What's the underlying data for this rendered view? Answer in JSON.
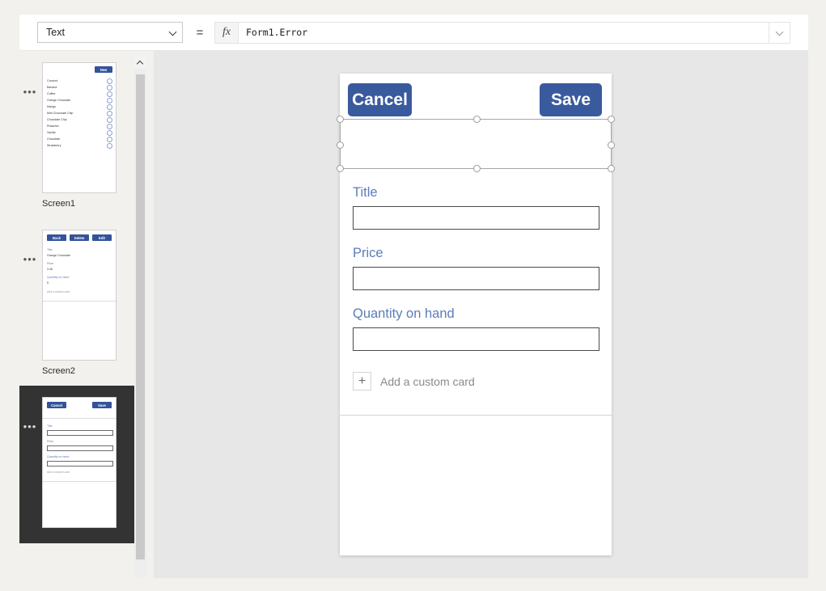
{
  "formula_bar": {
    "property_value": "Text",
    "equals": "=",
    "fx_label": "fx",
    "formula_value": "Form1.Error",
    "expand_icon": "chevron-down-icon",
    "dropdown_icon": "chevron-down-icon"
  },
  "screens": [
    {
      "name": "Screen1",
      "selected": false,
      "menu": "•••",
      "type": "browse",
      "new_button": "New",
      "items": [
        "Coconut",
        "Banana",
        "Coffee",
        "Orange Chocolate",
        "Mango",
        "Mint Chocolate Chip",
        "Chocolate Chip",
        "Pistachio",
        "Vanilla",
        "Chocolate",
        "Strawberry"
      ]
    },
    {
      "name": "Screen2",
      "selected": false,
      "menu": "•••",
      "type": "detail",
      "buttons": [
        "Back",
        "Delete",
        "Edit"
      ],
      "fields": [
        {
          "label": "Title",
          "value": "Orange Chocolate"
        },
        {
          "label": "Price",
          "value": "3.46"
        },
        {
          "label": "Quantity on hand",
          "value": "5"
        }
      ],
      "add_card": "Add a custom card"
    },
    {
      "name": "",
      "selected": true,
      "menu": "•••",
      "type": "edit",
      "buttons": [
        "Cancel",
        "Save"
      ],
      "fields": [
        {
          "label": "Title",
          "value": ""
        },
        {
          "label": "Price",
          "value": ""
        },
        {
          "label": "Quantity on hand",
          "value": ""
        }
      ],
      "add_card": "Add a custom card"
    }
  ],
  "scrollbar": {
    "up_icon": "chevron-up-icon"
  },
  "canvas": {
    "cancel_label": "Cancel",
    "save_label": "Save",
    "fields": [
      {
        "label": "Title",
        "value": "",
        "placeholder": ""
      },
      {
        "label": "Price",
        "value": "",
        "placeholder": ""
      },
      {
        "label": "Quantity on hand",
        "value": "",
        "placeholder": ""
      }
    ],
    "add_card_label": "Add a custom card",
    "add_card_icon": "plus-icon",
    "selection": {
      "handles": 8,
      "handle_icon": "resize-handle"
    }
  },
  "colors": {
    "button_blue": "#3a5a9e",
    "label_blue": "#5c7cb8",
    "canvas_bg": "#e7e7e7",
    "selected_row_bg": "#333333",
    "page_bg": "#f2f1ed"
  }
}
